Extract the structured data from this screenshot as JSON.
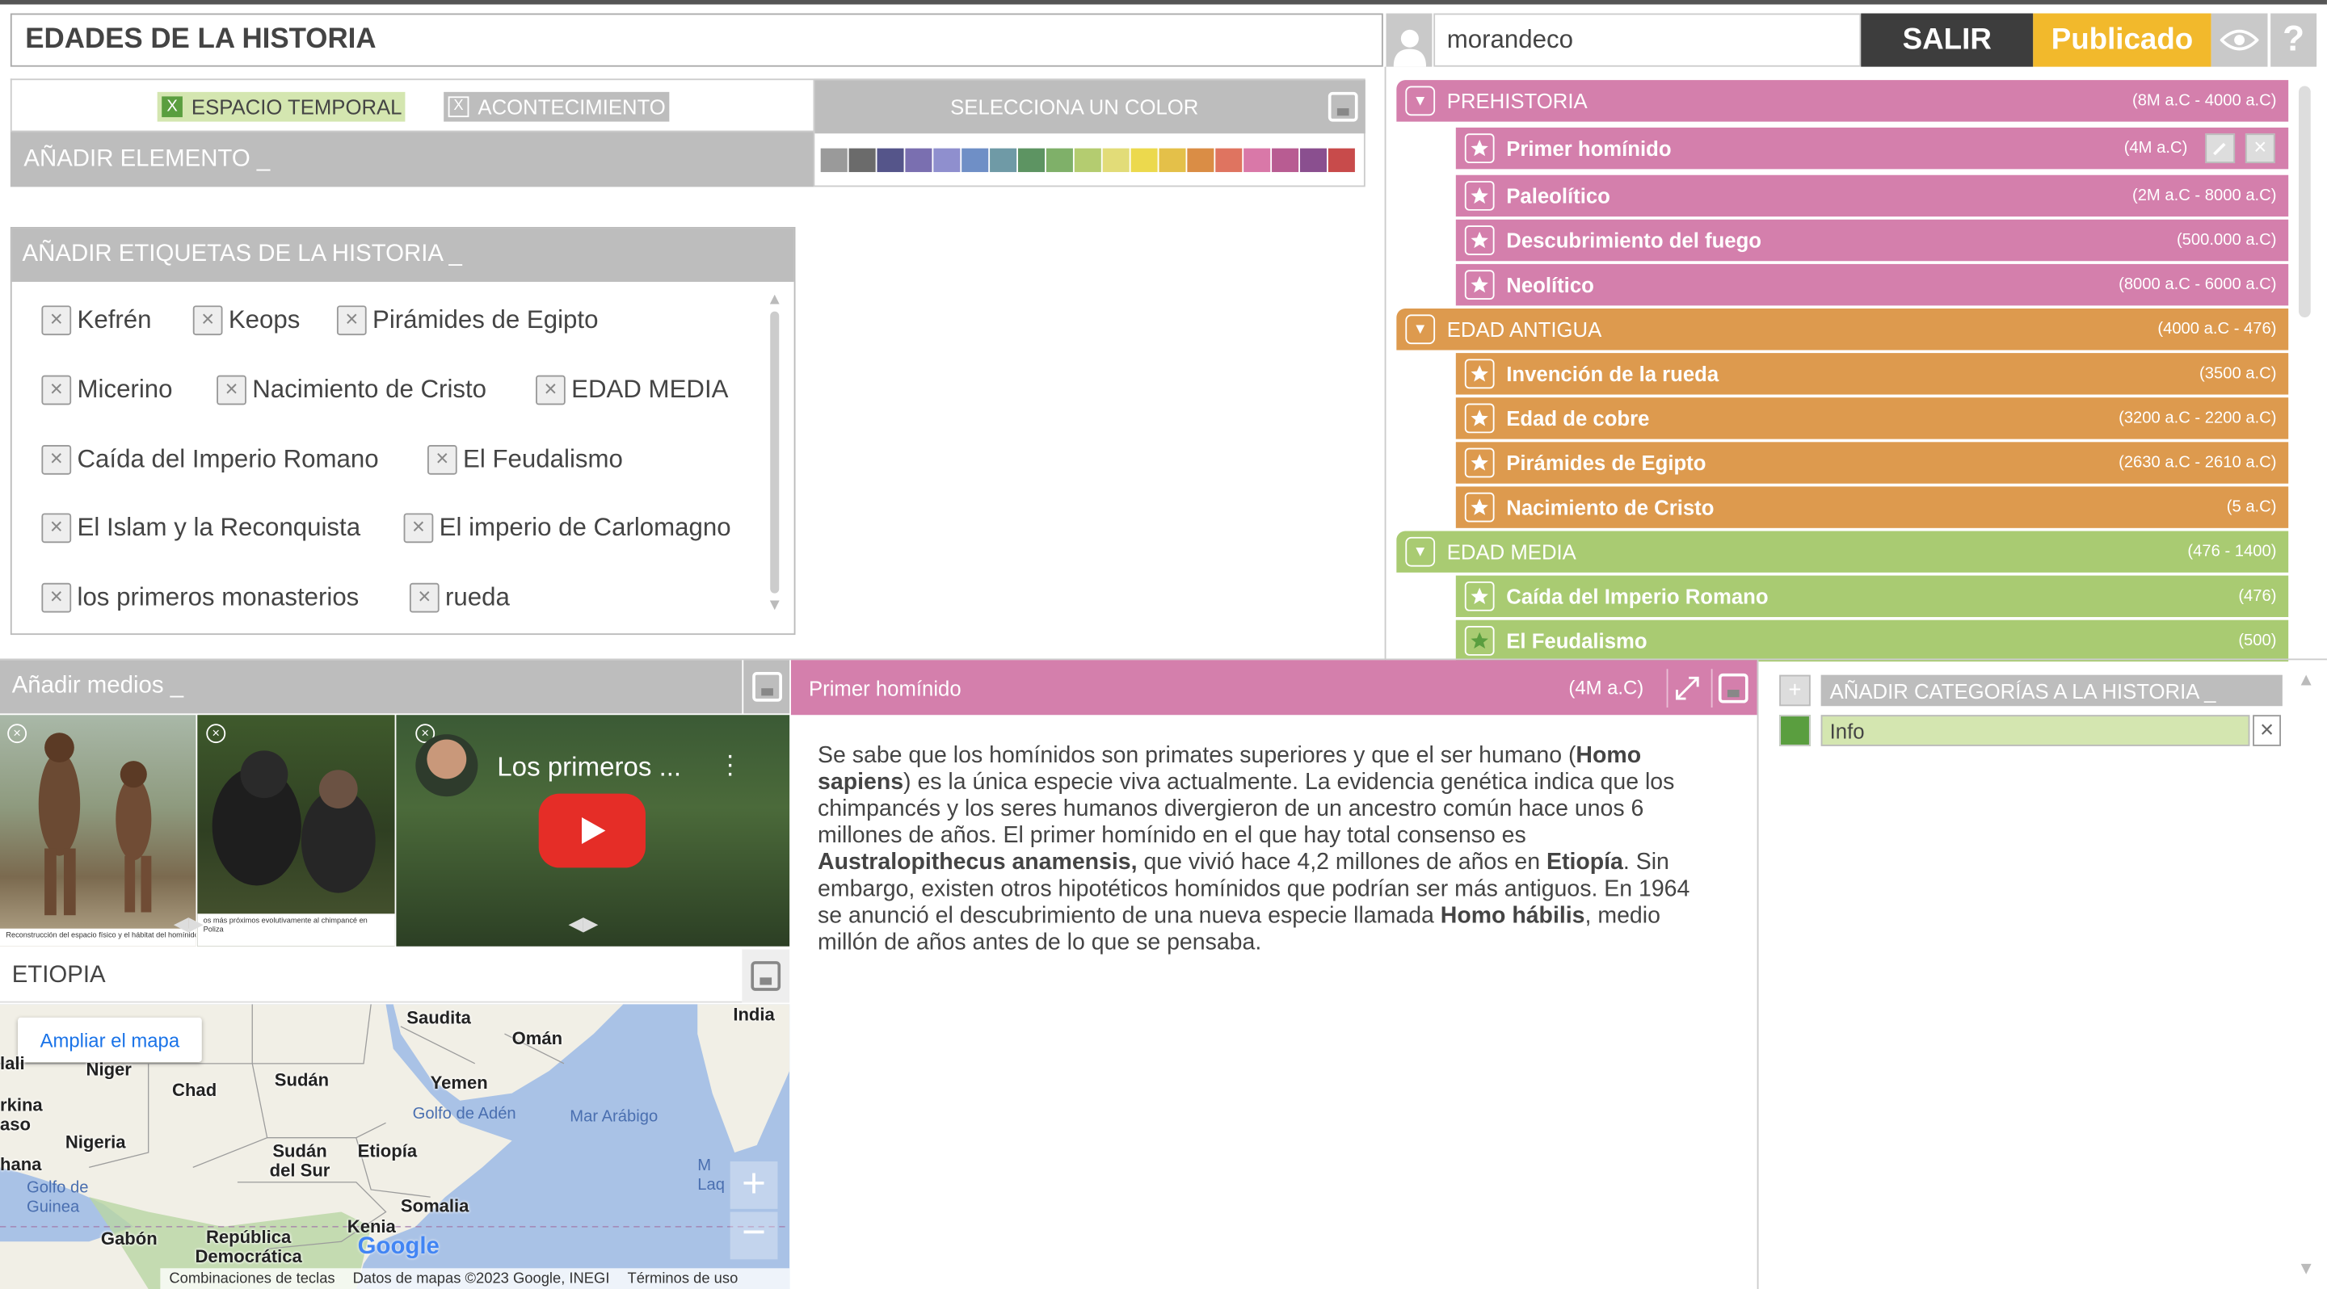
{
  "header": {
    "story_title": "EDADES DE LA HISTORIA",
    "username": "morandeco",
    "logout_label": "SALIR",
    "published_label": "Publicado",
    "help_label": "?"
  },
  "element_panel": {
    "type_temporal_label": "ESPACIO TEMPORAL",
    "type_event_label": "ACONTECIMIENTO",
    "add_element_label": "AÑADIR ELEMENTO _",
    "color_picker_label": "SELECCIONA UN COLOR",
    "colors": [
      "#9a9a9a",
      "#6b6b6b",
      "#55558a",
      "#7a6fb0",
      "#8f8fce",
      "#6f8fc6",
      "#6f9aa6",
      "#5d9462",
      "#7fb069",
      "#b4cc70",
      "#e2dc78",
      "#ecd94d",
      "#e4c049",
      "#da8d45",
      "#df7460",
      "#d978a8",
      "#b85c92",
      "#8a4f8f",
      "#c84b4b"
    ]
  },
  "tags_panel": {
    "title": "AÑADIR ETIQUETAS DE LA HISTORIA _",
    "tags": [
      "Kefrén",
      "Keops",
      "Pirámides de Egipto",
      "Micerino",
      "Nacimiento de Cristo",
      "EDAD MEDIA",
      "Caída del Imperio Romano",
      "El Feudalismo",
      "El Islam y la Reconquista",
      "El imperio de Carlomagno",
      "los primeros monasterios",
      "rueda"
    ]
  },
  "timeline": {
    "groups": [
      {
        "label": "PREHISTORIA",
        "date": "(8M a.C - 4000 a.C)",
        "color": "#d47fac",
        "items": [
          {
            "label": "Primer homínido",
            "date": "(4M a.C)"
          },
          {
            "label": "Paleolítico",
            "date": "(2M a.C - 8000 a.C)"
          },
          {
            "label": "Descubrimiento del fuego",
            "date": "(500.000 a.C)"
          },
          {
            "label": "Neolítico",
            "date": "(8000 a.C - 6000 a.C)"
          }
        ]
      },
      {
        "label": "EDAD ANTIGUA",
        "date": "(4000 a.C - 476)",
        "color": "#dd9a4e",
        "items": [
          {
            "label": "Invención de la rueda",
            "date": "(3500 a.C)"
          },
          {
            "label": "Edad de cobre",
            "date": "(3200 a.C - 2200 a.C)"
          },
          {
            "label": "Pirámides de Egipto",
            "date": "(2630 a.C - 2610 a.C)"
          },
          {
            "label": "Nacimiento de Cristo",
            "date": "(5 a.C)"
          }
        ]
      },
      {
        "label": "EDAD MEDIA",
        "date": "(476 - 1400)",
        "color": "#a9cb72",
        "items": [
          {
            "label": "Caída del Imperio Romano",
            "date": "(476)"
          },
          {
            "label": "El Feudalismo",
            "date": "(500)"
          }
        ]
      }
    ]
  },
  "media_panel": {
    "title": "Añadir medios _",
    "video_title": "Los primeros ...",
    "caption1": "Reconstrucción del espacio físico y el hábitat del homínido",
    "caption2": "os más próximos evolutivamente al chimpancé en Poliza"
  },
  "location_panel": {
    "place": "ETIOPIA",
    "enlarge_map": "Ampliar el mapa",
    "footer_shortcuts": "Combinaciones de teclas",
    "footer_data": "Datos de mapas ©2023 Google, INEGI",
    "footer_terms": "Términos de uso",
    "google": "Google",
    "labels": [
      "Saudita",
      "Omán",
      "India",
      "Niger",
      "Chad",
      "Sudán",
      "Yemen",
      "Golfo de Adén",
      "Mar Arábigo",
      "Nigeria",
      "Sudán del Sur",
      "Etiopía",
      "Golfo de Guinea",
      "Somalia",
      "Kenia",
      "Gabón",
      "República Democrática",
      "rkina aso",
      "hana",
      "lali",
      "M Laq"
    ]
  },
  "detail_panel": {
    "title": "Primer homínido",
    "date": "(4M a.C)",
    "body": [
      {
        "t": "Se sabe que los homínidos son primates superiores y que el ser humano (",
        "b": false
      },
      {
        "t": "Homo sapiens",
        "b": true
      },
      {
        "t": ") es la única especie viva actualmente. La evidencia genética indica que los chimpancés y los seres humanos divergieron de un ancestro común hace unos 6 millones de años. El primer homínido en el que hay total consenso es ",
        "b": false
      },
      {
        "t": "Australopithecus anamensis,",
        "b": true
      },
      {
        "t": " que vivió hace 4,2 millones de años en ",
        "b": false
      },
      {
        "t": "Etiopía",
        "b": true
      },
      {
        "t": ". Sin embargo, existen otros hipotéticos homínidos que podrían ser más antiguos. En 1964 se anunció el descubrimiento de una nueva especie llamada ",
        "b": false
      },
      {
        "t": "Homo hábilis",
        "b": true
      },
      {
        "t": ", medio millón de años antes de lo que se pensaba.",
        "b": false
      }
    ]
  },
  "categories_panel": {
    "title": "AÑADIR CATEGORÍAS A LA HISTORIA _",
    "items": [
      {
        "label": "Info",
        "color": "#5a9e3f"
      }
    ]
  }
}
